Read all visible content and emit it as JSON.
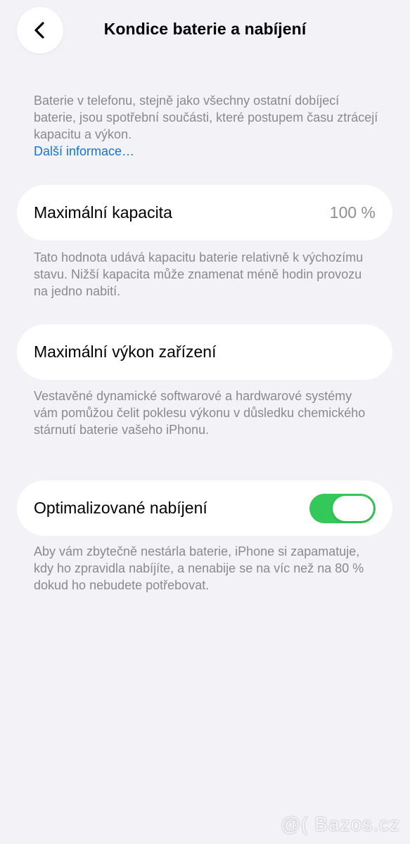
{
  "header": {
    "title": "Kondice baterie a nabíjení",
    "back_icon": "chevron-left-icon"
  },
  "intro": {
    "text": "Baterie v telefonu, stejně jako všechny ostatní dobíjecí baterie, jsou spotřební součásti, které postupem času ztrácejí kapacitu a výkon.",
    "link": "Další informace…",
    "link_color": "#1a73c9"
  },
  "capacity": {
    "label": "Maximální kapacita",
    "value": "100 %",
    "description": "Tato hodnota udává kapacitu baterie relativně k výchozímu stavu. Nižší kapacita může znamenat méně hodin provozu na jedno nabití."
  },
  "performance": {
    "label": "Maximální výkon zařízení",
    "description": "Vestavěné dynamické softwarové a hardwarové systémy vám pomůžou čelit poklesu výkonu v důsledku chemického stárnutí baterie vašeho iPhonu."
  },
  "charging": {
    "label": "Optimalizované nabíjení",
    "toggle_on": true,
    "toggle_color": "#34c759",
    "description": "Aby vám zbytečně nestárla baterie, iPhone si zapamatuje, kdy ho zpravidla nabíjíte, a nenabije se na víc než na 80 % dokud ho nebudete potřebovat."
  },
  "watermark": {
    "text": "@( Bazos.cz"
  }
}
